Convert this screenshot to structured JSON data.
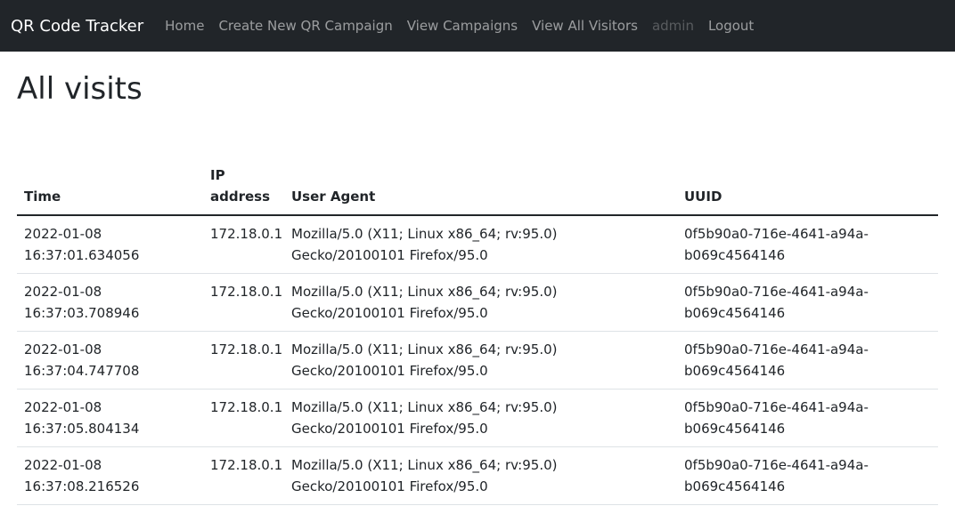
{
  "navbar": {
    "brand": "QR Code Tracker",
    "links": [
      {
        "label": "Home"
      },
      {
        "label": "Create New QR Campaign"
      },
      {
        "label": "View Campaigns"
      },
      {
        "label": "View All Visitors"
      },
      {
        "label": "admin"
      },
      {
        "label": "Logout"
      }
    ]
  },
  "page": {
    "title": "All visits"
  },
  "table": {
    "headers": [
      "Time",
      "IP address",
      "User Agent",
      "UUID"
    ],
    "rows": [
      {
        "time": "2022-01-08 16:37:01.634056",
        "ip": "172.18.0.1",
        "ua": "Mozilla/5.0 (X11; Linux x86_64; rv:95.0) Gecko/20100101 Firefox/95.0",
        "uuid": "0f5b90a0-716e-4641-a94a-b069c4564146"
      },
      {
        "time": "2022-01-08 16:37:03.708946",
        "ip": "172.18.0.1",
        "ua": "Mozilla/5.0 (X11; Linux x86_64; rv:95.0) Gecko/20100101 Firefox/95.0",
        "uuid": "0f5b90a0-716e-4641-a94a-b069c4564146"
      },
      {
        "time": "2022-01-08 16:37:04.747708",
        "ip": "172.18.0.1",
        "ua": "Mozilla/5.0 (X11; Linux x86_64; rv:95.0) Gecko/20100101 Firefox/95.0",
        "uuid": "0f5b90a0-716e-4641-a94a-b069c4564146"
      },
      {
        "time": "2022-01-08 16:37:05.804134",
        "ip": "172.18.0.1",
        "ua": "Mozilla/5.0 (X11; Linux x86_64; rv:95.0) Gecko/20100101 Firefox/95.0",
        "uuid": "0f5b90a0-716e-4641-a94a-b069c4564146"
      },
      {
        "time": "2022-01-08 16:37:08.216526",
        "ip": "172.18.0.1",
        "ua": "Mozilla/5.0 (X11; Linux x86_64; rv:95.0) Gecko/20100101 Firefox/95.0",
        "uuid": "0f5b90a0-716e-4641-a94a-b069c4564146"
      }
    ]
  }
}
